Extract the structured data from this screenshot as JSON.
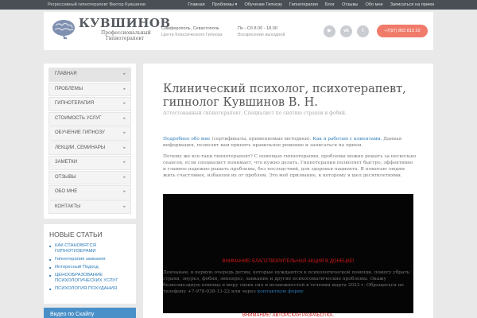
{
  "topbar": {
    "tagline": "Регрессивный гипнотерапевт Виктор Кувшинов",
    "menu": [
      "Главная",
      "Проблемы ▾",
      "Обучение Гипнозу",
      "Гипнотерапия",
      "Блог",
      "Отзывы",
      "Обо мне",
      "Записаться на прием"
    ]
  },
  "header": {
    "logo_name": "КУВШИНОВ",
    "logo_sub": "Профессиональный Гипнотерапевт",
    "city_line1": "Симферополь, Севастополь",
    "city_line2": "Центр Классического Гипноза",
    "hours_line1": "Пн - Сб 8.00 - 18.00",
    "hours_line2": "Воскресение выходной",
    "social": [
      {
        "icon": "youtube-icon",
        "glyph": "▶"
      },
      {
        "icon": "vk-icon",
        "glyph": "vk"
      },
      {
        "icon": "twitter-icon",
        "glyph": "t"
      }
    ],
    "phone": "+7(97) 803 813 22"
  },
  "nav": {
    "items": [
      {
        "label": "Главная",
        "active": true
      },
      {
        "label": "Проблемы",
        "active": false
      },
      {
        "label": "Гипнотерапия",
        "active": false
      },
      {
        "label": "Стоимость услуг",
        "active": false
      },
      {
        "label": "Обучение гипнозу",
        "active": false
      },
      {
        "label": "Лекции, семинары",
        "active": false
      },
      {
        "label": "Заметки",
        "active": false
      },
      {
        "label": "Отзывы",
        "active": false
      },
      {
        "label": "Обо мне",
        "active": false
      },
      {
        "label": "Контакты",
        "active": false
      }
    ],
    "arrow": "▸"
  },
  "new_articles": {
    "heading": "Новые статьи",
    "items": [
      "КАК СТАНОВЯТСЯ ГИПНОТИЗЕРАМИ",
      "Гипнотерапия заикания",
      "Интересный Подход",
      "ЦЕНООБРАЗОВАНИЕ ПСИХОЛОГИЧЕСКИХ УСЛУГ",
      "ПСИХОЛОГИЯ ПОХУДАНИЯ"
    ]
  },
  "bottom_widget": {
    "label": "Видео по Скайпу"
  },
  "main": {
    "title": "Клинический психолог, психотерапевт, гипнолог Кувшинов В. Н.",
    "subtitle": "Аттестованный гипнотерапевт. Специалист по снятию страхов и фобий.",
    "p1_link1": "Подробнее обо мне",
    "p1_text1": " (сертификаты, применяемые методики). ",
    "p1_link2": "Как я работаю с клиентами.",
    "p1_text2": " Данная информация, позволит вам принять правильное решение и записаться на прием.",
    "p2": "Почему же все-таки гипнотерапевт? С помощью гипнотерапии, проблемы можно решать за несколько сеансов, если специалист понимает, что нужно делать. Гипнотерапия позволяет быстро, эффективно и главное надежно решать проблемы, без последствий, для здоровья пациента. Я помогаю людям жить счастливее, избавляя их от проблем. Это моё призвание, к которому я шел десятилетиями.",
    "promo1": "ВНИМАНИЕ! БЛАГОТВОРИТЕЛЬНАЯ АКЦИЯ В ДОНЕЦКЕ!",
    "p3_text": "Дончанам, в первую очередь детям, которые нуждаются в психологической помощи, помогу убрать: страхи, энурез, фобии, энкопрез, заикание и другие психосоматические проблемы. Окажу безвозмездную помощь в меру своих сил и возможностей в течении марта 2023 г. Обращаться по телефону +7-978-038-13-22 или через ",
    "p3_link": "контактную форму",
    "promo2": "ВНИМАНИЕ! АВТОРСКАЯ РАЗРАБОТКА."
  }
}
